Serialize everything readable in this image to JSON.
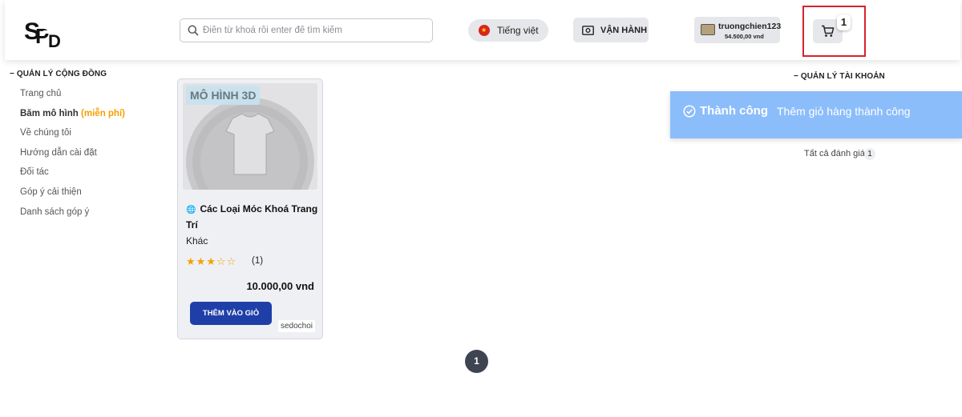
{
  "header": {
    "logo_text": "SPD",
    "search_placeholder": "Điền từ khoá rồi enter để tìm kiếm",
    "language_label": "Tiếng việt",
    "operations_label": "VẬN HÀNH",
    "user": {
      "name": "truongchien123",
      "balance": "54.500,00 vnd"
    },
    "cart_count": "1"
  },
  "sidebar": {
    "title": "QUẢN LÝ CỘNG ĐỒNG",
    "items": [
      {
        "label": "Trang chủ"
      },
      {
        "label": "Băm mô hình",
        "tag": "(miễn phí)"
      },
      {
        "label": "Về chúng tôi"
      },
      {
        "label": "Hướng dẫn cài đặt"
      },
      {
        "label": "Đối tác"
      },
      {
        "label": "Góp ý cải thiện"
      },
      {
        "label": "Danh sách góp ý"
      }
    ]
  },
  "product": {
    "badge": "MÔ HÌNH 3D",
    "title": "Các Loại Móc Khoá Trang Trí",
    "category": "Khác",
    "rating": 3,
    "rating_max": 5,
    "rating_count": "(1)",
    "price": "10.000,00 vnd",
    "add_to_cart_label": "THÊM VÀO GIỎ",
    "seller": "sedochoi"
  },
  "pagination": {
    "current": "1"
  },
  "account": {
    "title": "QUẢN LÝ TÀI KHOẢN",
    "all_reviews_label": "Tất cả đánh giá",
    "all_reviews_count": "1"
  },
  "toast": {
    "title": "Thành công",
    "message": "Thêm giỏ hàng thành công",
    "color": "#8cbdfb"
  },
  "colors": {
    "primary_button": "#1f3fa8",
    "accent_free": "#f5a000",
    "cart_highlight": "#d6232a"
  },
  "icons": [
    "search-icon",
    "flag-icon",
    "camera-icon",
    "cart-icon",
    "globe-icon",
    "check-circle-icon",
    "star-icon"
  ]
}
